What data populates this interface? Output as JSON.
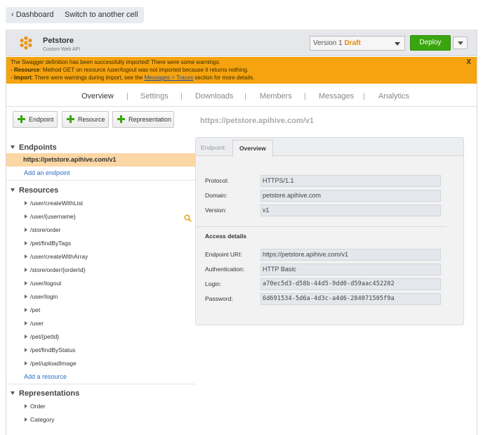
{
  "topbar": {
    "dashboard_label": "‹ Dashboard",
    "switch_label": "Switch to another cell"
  },
  "header": {
    "app_name": "Petstore",
    "app_subtitle": "Custom Web API",
    "version_label": "Version 1",
    "version_status": "Draft",
    "deploy_label": "Deploy"
  },
  "warning": {
    "line1": "The Swagger definition has been successfully imported! There were some warnings:",
    "line2_key": "Resource",
    "line2_text": ": Method GET on resource /user/logout was not imported because it returns nothing.",
    "line3_key": "Import",
    "line3_text_before": ": There were warnings during import, see the ",
    "line3_link": "Messages > Traces",
    "line3_text_after": " section for more details.",
    "close_label": "X"
  },
  "tabs": [
    "Overview",
    "Settings",
    "Downloads",
    "Members",
    "Messages",
    "Analytics"
  ],
  "tab_separator": "|",
  "toolbar": {
    "endpoint_label": "Endpoint",
    "resource_label": "Resource",
    "representation_label": "Representation",
    "base_url": "https://petstore.apihive.com/v1"
  },
  "sidebar": {
    "endpoints_title": "Endpoints",
    "selected_endpoint": "https://petstore.apihive.com/v1",
    "add_endpoint": "Add an endpoint",
    "resources_title": "Resources",
    "resources": [
      "/user/createWithList",
      "/user/{username}",
      "/store/order",
      "/pet/findByTags",
      "/user/createWithArray",
      "/store/order/{orderId}",
      "/user/logout",
      "/user/login",
      "/pet",
      "/user",
      "/pet/{petId}",
      "/pet/findByStatus",
      "/pet/uploadImage"
    ],
    "add_resource": "Add a resource",
    "representations_title": "Representations",
    "representations": [
      "Order",
      "Category"
    ]
  },
  "panel": {
    "tab_label": "Endpoint:",
    "tab_active": "Overview",
    "protocol_label": "Protocol:",
    "protocol_value": "HTTPS/1.1",
    "domain_label": "Domain:",
    "domain_value": "petstore.apihive.com",
    "version_label": "Version:",
    "version_value": "v1",
    "access_title": "Access details",
    "uri_label": "Endpoint URI:",
    "uri_value": "https://petstore.apihive.com/v1",
    "auth_label": "Authentication:",
    "auth_value": "HTTP Basic",
    "login_label": "Login:",
    "login_value": "a70ec5d3-d58b-44d5-9dd0-d59aac452202",
    "password_label": "Password:",
    "password_value": "6d691534-5d6a-4d3c-a4d6-284071505f9a"
  },
  "colors": {
    "accent_green": "#3aa60f",
    "warning_orange": "#f5a30e",
    "selected_row": "#fbd7a5",
    "link_blue": "#2e6ec2",
    "draft_orange": "#e08a10"
  },
  "icons": [
    "logo-icon",
    "caret-down-icon",
    "plus-icon",
    "search-icon",
    "triangle-down-icon",
    "triangle-right-icon"
  ]
}
